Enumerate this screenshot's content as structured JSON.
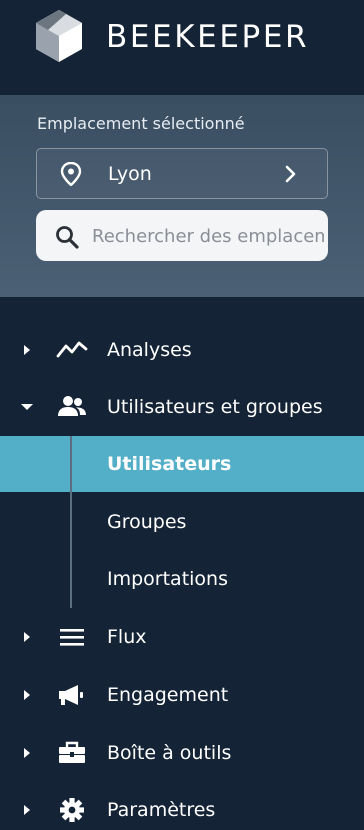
{
  "brand": {
    "name": "BEEKEEPER",
    "logo_icon": "beekeeper-cube-logo"
  },
  "location": {
    "label": "Emplacement sélectionné",
    "selected": "Lyon",
    "pin_icon": "map-pin-icon",
    "chevron_icon": "chevron-right-icon"
  },
  "search": {
    "placeholder": "Rechercher des emplacements",
    "value": ""
  },
  "nav": {
    "items": [
      {
        "label": "Analyses",
        "icon": "analytics-line-icon",
        "expanded": false
      },
      {
        "label": "Utilisateurs et groupes",
        "icon": "users-icon",
        "expanded": true,
        "children": [
          {
            "label": "Utilisateurs",
            "active": true
          },
          {
            "label": "Groupes",
            "active": false
          },
          {
            "label": "Importations",
            "active": false
          }
        ]
      },
      {
        "label": "Flux",
        "icon": "menu-lines-icon",
        "expanded": false
      },
      {
        "label": "Engagement",
        "icon": "megaphone-icon",
        "expanded": false
      },
      {
        "label": "Boîte à outils",
        "icon": "toolbox-icon",
        "expanded": false
      },
      {
        "label": "Paramètres",
        "icon": "gear-icon",
        "expanded": false
      }
    ]
  },
  "colors": {
    "background": "#142335",
    "panel": "#43576b",
    "active": "#52afc7",
    "text": "#ffffff"
  }
}
